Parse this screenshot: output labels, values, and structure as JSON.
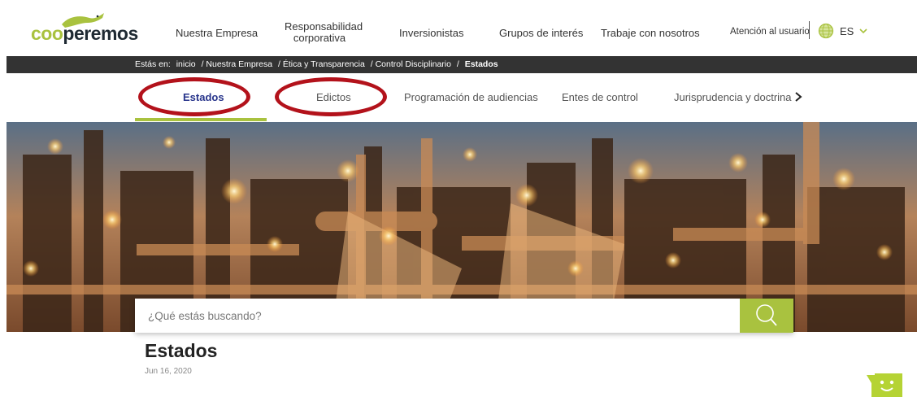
{
  "header": {
    "logo_text_prefix": "coo",
    "logo_text_suffix": "peremos",
    "nav_items": [
      {
        "label": "Nuestra Empresa"
      },
      {
        "label_line1": "Responsabilidad",
        "label_line2": "corporativa"
      },
      {
        "label": "Inversionistas"
      },
      {
        "label": "Grupos de interés"
      },
      {
        "label": "Trabaje con nosotros"
      }
    ],
    "user_link": "Atención al usuario",
    "language": "ES"
  },
  "breadcrumb": {
    "prefix": "Estás en:",
    "items": [
      "inicio",
      "/ Nuestra Empresa",
      "/ Ética y Transparencia",
      "/ Control Disciplinario",
      "/"
    ],
    "current": "Estados"
  },
  "tabs": {
    "items": [
      {
        "label": "Estados",
        "active": true
      },
      {
        "label": "Edictos",
        "active": false
      },
      {
        "label": "Programación de audiencias",
        "active": false
      },
      {
        "label": "Entes de control",
        "active": false
      },
      {
        "label": "Jurisprudencia y doctrina",
        "active": false
      }
    ],
    "accent": "#a9c23f",
    "annotation_color": "#b3121b"
  },
  "search": {
    "placeholder": "¿Qué estás buscando?"
  },
  "page": {
    "title": "Estados",
    "date": "Jun 16, 2020"
  },
  "colors": {
    "brand_green": "#a9c23f",
    "brand_dark": "#1f2a33",
    "crumb_bar": "#333333",
    "active_tab": "#27348b"
  },
  "icons": {
    "globe": "globe-icon",
    "chevron": "chevron-down-icon",
    "next": "chevron-right-icon",
    "search": "search-icon",
    "chat": "chatbot-icon"
  }
}
